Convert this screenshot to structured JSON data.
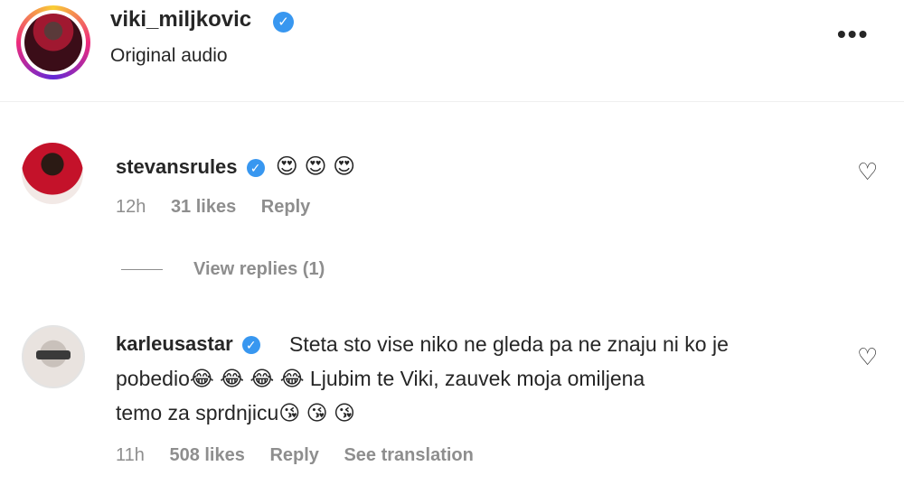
{
  "post": {
    "author": "viki_miljkovic",
    "audio": "Original audio",
    "more_icon": "more-options-icon"
  },
  "comments": [
    {
      "username": "stevansrules",
      "text": "",
      "emojis": "😍 😍 😍",
      "time": "12h",
      "likes": "31 likes",
      "reply": "Reply",
      "view_replies": "View replies (1)"
    },
    {
      "username": "karleusastar",
      "line1": "Steta sto vise niko ne gleda pa ne znaju ni ko je",
      "line2": "pobedio😂 😂 😂 😂  Ljubim te Viki, zauvek moja omiljena",
      "line3": "temo za sprdnjicu😘 😘 😘",
      "time": "11h",
      "likes": "508 likes",
      "reply": "Reply",
      "translate": "See translation"
    }
  ],
  "colors": {
    "verified": "#3897f0",
    "muted": "#8e8e8e",
    "text": "#262626"
  }
}
